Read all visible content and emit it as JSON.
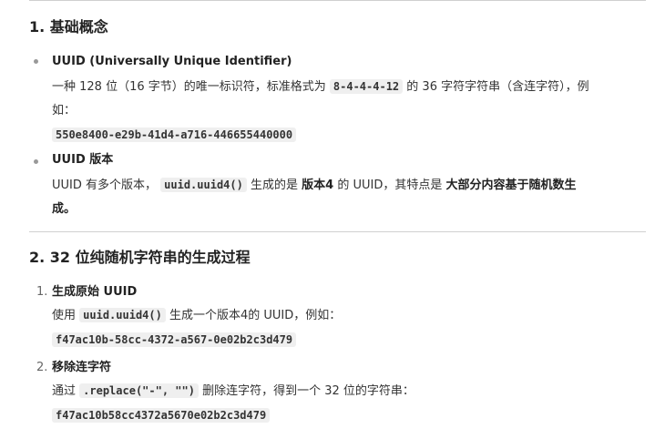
{
  "sections": [
    {
      "heading": "1. 基础概念",
      "items": [
        {
          "title": "UUID (Universally Unique Identifier)",
          "desc_part1": "一种 128 位（16 字节）的唯一标识符，标准格式为",
          "code_inline": "8-4-4-4-12",
          "desc_part2": "的 36 字符字符串（含连字符），例",
          "desc_part3": "如：",
          "code_block": "550e8400-e29b-41d4-a716-446655440000"
        },
        {
          "title": "UUID 版本",
          "desc_part1": "UUID 有多个版本，",
          "code_inline": "uuid.uuid4()",
          "desc_part2": "生成的是",
          "bold1": "版本4",
          "desc_part3": "的 UUID，其特点是",
          "bold2": "大部分内容基于随机数生",
          "bold3": "成。"
        }
      ]
    },
    {
      "heading": "2. 32 位纯随机字符串的生成过程",
      "steps": [
        {
          "number": "1.",
          "title": "生成原始 UUID",
          "desc_part1": "使用",
          "code_inline": "uuid.uuid4()",
          "desc_part2": "生成一个版本4的 UUID，例如：",
          "code_block": "f47ac10b-58cc-4372-a567-0e02b2c3d479"
        },
        {
          "number": "2.",
          "title": "移除连字符",
          "desc_part1": "通过",
          "code_inline": ".replace(\"-\", \"\")",
          "desc_part2": "删除连字符，得到一个 32 位的字符串：",
          "code_block": "f47ac10b58cc4372a5670e02b2c3d479"
        }
      ]
    }
  ]
}
